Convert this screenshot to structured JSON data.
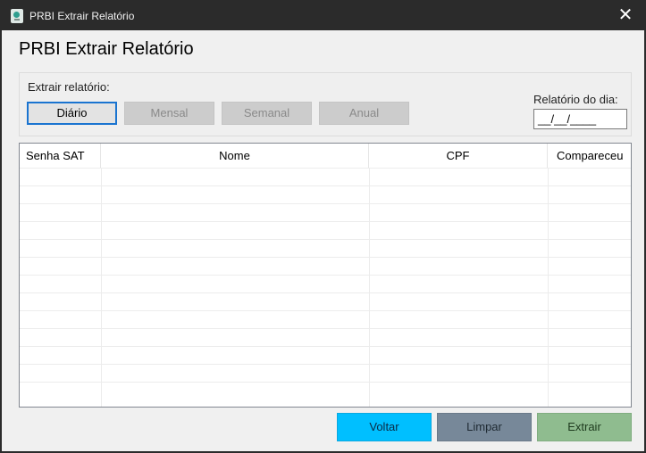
{
  "window": {
    "title": "PRBI Extrair Relatório",
    "close_glyph": "✕"
  },
  "form": {
    "heading": "PRBI Extrair Relatório"
  },
  "extract_group": {
    "label": "Extrair relatório:",
    "buttons": [
      {
        "label": "Diário",
        "state": "focused"
      },
      {
        "label": "Mensal",
        "state": "disabled"
      },
      {
        "label": "Semanal",
        "state": "disabled"
      },
      {
        "label": "Anual",
        "state": "disabled"
      }
    ],
    "day_label": "Relatório do dia:",
    "day_value": "__/__/____"
  },
  "table": {
    "columns": [
      "Senha SAT",
      "Nome",
      "CPF",
      "Compareceu"
    ],
    "rows": []
  },
  "actions": {
    "back_label": "Voltar",
    "clear_label": "Limpar",
    "extract_label": "Extrair"
  },
  "colors": {
    "back": "#00bfff",
    "clear": "#778899",
    "extract": "#8fbc8f",
    "focus": "#1a74d0"
  }
}
